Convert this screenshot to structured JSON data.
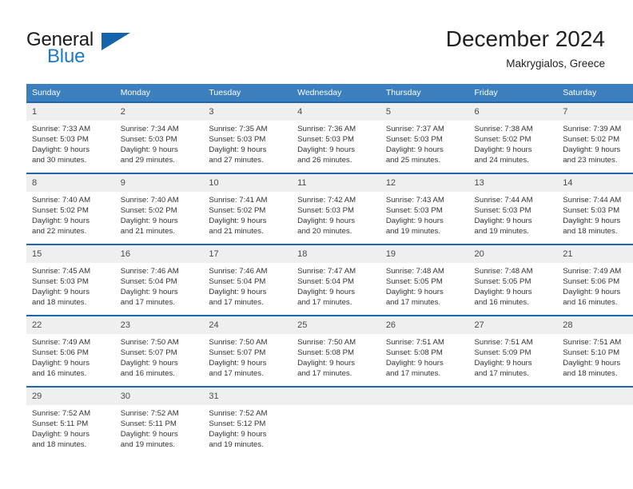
{
  "brand": {
    "name_top": "General",
    "name_bottom": "Blue",
    "triangle_icon": "triangle-icon",
    "color_dark": "#1a1a1a",
    "color_blue": "#1d7ac4"
  },
  "header": {
    "title": "December 2024",
    "subtitle": "Makrygialos, Greece"
  },
  "theme": {
    "header_bg": "#3b7fbe",
    "cell_top_border": "#1c67ad",
    "daynum_bg": "#efefef"
  },
  "weekday_headers": [
    "Sunday",
    "Monday",
    "Tuesday",
    "Wednesday",
    "Thursday",
    "Friday",
    "Saturday"
  ],
  "weeks": [
    [
      {
        "day": "1",
        "sunrise": "Sunrise: 7:33 AM",
        "sunset": "Sunset: 5:03 PM",
        "daylight1": "Daylight: 9 hours",
        "daylight2": "and 30 minutes."
      },
      {
        "day": "2",
        "sunrise": "Sunrise: 7:34 AM",
        "sunset": "Sunset: 5:03 PM",
        "daylight1": "Daylight: 9 hours",
        "daylight2": "and 29 minutes."
      },
      {
        "day": "3",
        "sunrise": "Sunrise: 7:35 AM",
        "sunset": "Sunset: 5:03 PM",
        "daylight1": "Daylight: 9 hours",
        "daylight2": "and 27 minutes."
      },
      {
        "day": "4",
        "sunrise": "Sunrise: 7:36 AM",
        "sunset": "Sunset: 5:03 PM",
        "daylight1": "Daylight: 9 hours",
        "daylight2": "and 26 minutes."
      },
      {
        "day": "5",
        "sunrise": "Sunrise: 7:37 AM",
        "sunset": "Sunset: 5:03 PM",
        "daylight1": "Daylight: 9 hours",
        "daylight2": "and 25 minutes."
      },
      {
        "day": "6",
        "sunrise": "Sunrise: 7:38 AM",
        "sunset": "Sunset: 5:02 PM",
        "daylight1": "Daylight: 9 hours",
        "daylight2": "and 24 minutes."
      },
      {
        "day": "7",
        "sunrise": "Sunrise: 7:39 AM",
        "sunset": "Sunset: 5:02 PM",
        "daylight1": "Daylight: 9 hours",
        "daylight2": "and 23 minutes."
      }
    ],
    [
      {
        "day": "8",
        "sunrise": "Sunrise: 7:40 AM",
        "sunset": "Sunset: 5:02 PM",
        "daylight1": "Daylight: 9 hours",
        "daylight2": "and 22 minutes."
      },
      {
        "day": "9",
        "sunrise": "Sunrise: 7:40 AM",
        "sunset": "Sunset: 5:02 PM",
        "daylight1": "Daylight: 9 hours",
        "daylight2": "and 21 minutes."
      },
      {
        "day": "10",
        "sunrise": "Sunrise: 7:41 AM",
        "sunset": "Sunset: 5:02 PM",
        "daylight1": "Daylight: 9 hours",
        "daylight2": "and 21 minutes."
      },
      {
        "day": "11",
        "sunrise": "Sunrise: 7:42 AM",
        "sunset": "Sunset: 5:03 PM",
        "daylight1": "Daylight: 9 hours",
        "daylight2": "and 20 minutes."
      },
      {
        "day": "12",
        "sunrise": "Sunrise: 7:43 AM",
        "sunset": "Sunset: 5:03 PM",
        "daylight1": "Daylight: 9 hours",
        "daylight2": "and 19 minutes."
      },
      {
        "day": "13",
        "sunrise": "Sunrise: 7:44 AM",
        "sunset": "Sunset: 5:03 PM",
        "daylight1": "Daylight: 9 hours",
        "daylight2": "and 19 minutes."
      },
      {
        "day": "14",
        "sunrise": "Sunrise: 7:44 AM",
        "sunset": "Sunset: 5:03 PM",
        "daylight1": "Daylight: 9 hours",
        "daylight2": "and 18 minutes."
      }
    ],
    [
      {
        "day": "15",
        "sunrise": "Sunrise: 7:45 AM",
        "sunset": "Sunset: 5:03 PM",
        "daylight1": "Daylight: 9 hours",
        "daylight2": "and 18 minutes."
      },
      {
        "day": "16",
        "sunrise": "Sunrise: 7:46 AM",
        "sunset": "Sunset: 5:04 PM",
        "daylight1": "Daylight: 9 hours",
        "daylight2": "and 17 minutes."
      },
      {
        "day": "17",
        "sunrise": "Sunrise: 7:46 AM",
        "sunset": "Sunset: 5:04 PM",
        "daylight1": "Daylight: 9 hours",
        "daylight2": "and 17 minutes."
      },
      {
        "day": "18",
        "sunrise": "Sunrise: 7:47 AM",
        "sunset": "Sunset: 5:04 PM",
        "daylight1": "Daylight: 9 hours",
        "daylight2": "and 17 minutes."
      },
      {
        "day": "19",
        "sunrise": "Sunrise: 7:48 AM",
        "sunset": "Sunset: 5:05 PM",
        "daylight1": "Daylight: 9 hours",
        "daylight2": "and 17 minutes."
      },
      {
        "day": "20",
        "sunrise": "Sunrise: 7:48 AM",
        "sunset": "Sunset: 5:05 PM",
        "daylight1": "Daylight: 9 hours",
        "daylight2": "and 16 minutes."
      },
      {
        "day": "21",
        "sunrise": "Sunrise: 7:49 AM",
        "sunset": "Sunset: 5:06 PM",
        "daylight1": "Daylight: 9 hours",
        "daylight2": "and 16 minutes."
      }
    ],
    [
      {
        "day": "22",
        "sunrise": "Sunrise: 7:49 AM",
        "sunset": "Sunset: 5:06 PM",
        "daylight1": "Daylight: 9 hours",
        "daylight2": "and 16 minutes."
      },
      {
        "day": "23",
        "sunrise": "Sunrise: 7:50 AM",
        "sunset": "Sunset: 5:07 PM",
        "daylight1": "Daylight: 9 hours",
        "daylight2": "and 16 minutes."
      },
      {
        "day": "24",
        "sunrise": "Sunrise: 7:50 AM",
        "sunset": "Sunset: 5:07 PM",
        "daylight1": "Daylight: 9 hours",
        "daylight2": "and 17 minutes."
      },
      {
        "day": "25",
        "sunrise": "Sunrise: 7:50 AM",
        "sunset": "Sunset: 5:08 PM",
        "daylight1": "Daylight: 9 hours",
        "daylight2": "and 17 minutes."
      },
      {
        "day": "26",
        "sunrise": "Sunrise: 7:51 AM",
        "sunset": "Sunset: 5:08 PM",
        "daylight1": "Daylight: 9 hours",
        "daylight2": "and 17 minutes."
      },
      {
        "day": "27",
        "sunrise": "Sunrise: 7:51 AM",
        "sunset": "Sunset: 5:09 PM",
        "daylight1": "Daylight: 9 hours",
        "daylight2": "and 17 minutes."
      },
      {
        "day": "28",
        "sunrise": "Sunrise: 7:51 AM",
        "sunset": "Sunset: 5:10 PM",
        "daylight1": "Daylight: 9 hours",
        "daylight2": "and 18 minutes."
      }
    ],
    [
      {
        "day": "29",
        "sunrise": "Sunrise: 7:52 AM",
        "sunset": "Sunset: 5:11 PM",
        "daylight1": "Daylight: 9 hours",
        "daylight2": "and 18 minutes."
      },
      {
        "day": "30",
        "sunrise": "Sunrise: 7:52 AM",
        "sunset": "Sunset: 5:11 PM",
        "daylight1": "Daylight: 9 hours",
        "daylight2": "and 19 minutes."
      },
      {
        "day": "31",
        "sunrise": "Sunrise: 7:52 AM",
        "sunset": "Sunset: 5:12 PM",
        "daylight1": "Daylight: 9 hours",
        "daylight2": "and 19 minutes."
      },
      {
        "day": "",
        "sunrise": "",
        "sunset": "",
        "daylight1": "",
        "daylight2": ""
      },
      {
        "day": "",
        "sunrise": "",
        "sunset": "",
        "daylight1": "",
        "daylight2": ""
      },
      {
        "day": "",
        "sunrise": "",
        "sunset": "",
        "daylight1": "",
        "daylight2": ""
      },
      {
        "day": "",
        "sunrise": "",
        "sunset": "",
        "daylight1": "",
        "daylight2": ""
      }
    ]
  ]
}
